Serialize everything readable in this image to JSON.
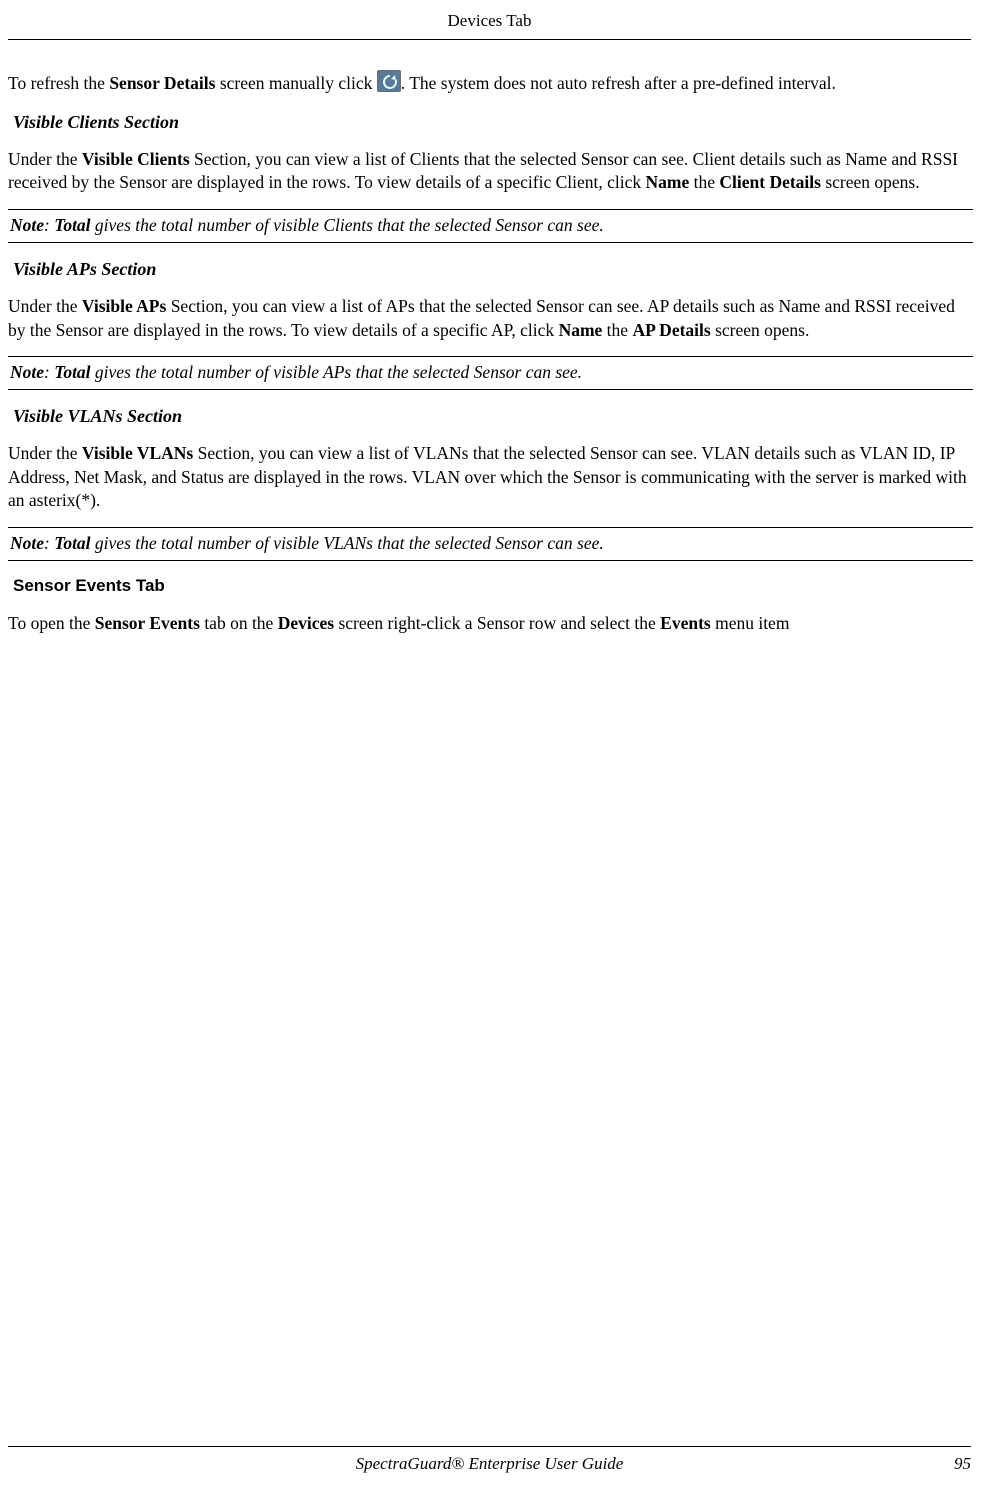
{
  "header": {
    "title": "Devices Tab"
  },
  "intro": {
    "pre": "To refresh the ",
    "b1": "Sensor Details",
    "mid": " screen manually click ",
    "post": ". The system does not auto refresh after a pre-defined interval."
  },
  "sections": {
    "clients": {
      "heading": "Visible Clients Section",
      "p_lead": "Under the ",
      "p_b1": "Visible Clients",
      "p_mid1": " Section, you can view a list of Clients that the selected Sensor can see. Client details such as Name and RSSI received by the Sensor are displayed in the rows. To view details of a specific Client, click ",
      "p_b2": "Name",
      "p_mid2": " the ",
      "p_b3": "Client Details",
      "p_tail": " screen opens.",
      "note_label": "Note",
      "note_sep": ": ",
      "note_strong": "Total",
      "note_tail": " gives the total number of visible Clients that the selected Sensor can see."
    },
    "aps": {
      "heading": "Visible APs Section",
      "p_lead": "Under the ",
      "p_b1": "Visible APs",
      "p_mid1": " Section, you can view a list of APs that the selected Sensor can see. AP details such as Name and RSSI received by the Sensor are displayed in the rows. To view details of a specific AP, click ",
      "p_b2": "Name",
      "p_mid2": " the ",
      "p_b3": "AP Details",
      "p_tail": " screen opens.",
      "note_label": "Note",
      "note_sep": ": ",
      "note_strong": "Total",
      "note_tail": " gives the total number of visible APs that the selected Sensor can see."
    },
    "vlans": {
      "heading": "Visible VLANs Section",
      "p_lead": "Under the ",
      "p_b1": "Visible VLANs",
      "p_tail": " Section, you can view a list of VLANs that the selected Sensor can see. VLAN details such as VLAN ID, IP Address, Net Mask, and Status are displayed in the rows. VLAN over which the Sensor is communicating with the server is marked with an asterix(*).",
      "note_label": "Note",
      "note_sep": ": ",
      "note_strong": "Total",
      "note_tail": " gives the total number of visible VLANs that the selected Sensor can see."
    },
    "events": {
      "heading": "Sensor Events Tab",
      "p_lead": "To open the ",
      "p_b1": "Sensor Events",
      "p_mid1": " tab on the ",
      "p_b2": "Devices",
      "p_mid2": " screen right-click a Sensor row and select the ",
      "p_b3": "Events",
      "p_tail": " menu item"
    }
  },
  "footer": {
    "center": "SpectraGuard®  Enterprise User Guide",
    "page": "95"
  }
}
